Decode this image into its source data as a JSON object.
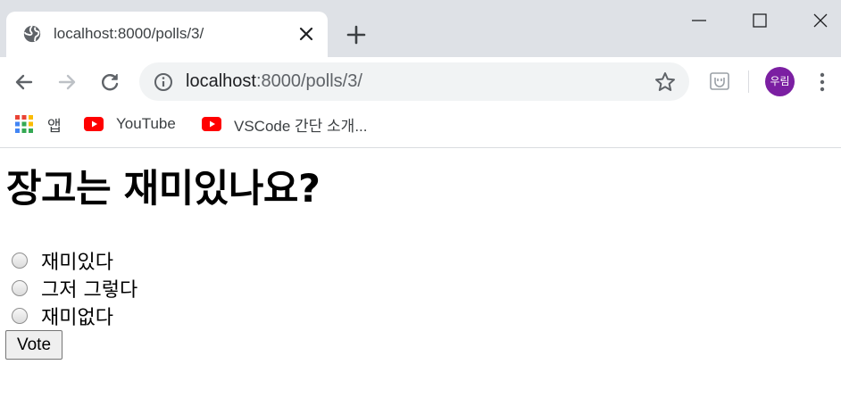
{
  "browser": {
    "tab": {
      "title": "localhost:8000/polls/3/"
    },
    "address_bar": {
      "host": "localhost",
      "rest": ":8000/polls/3/"
    },
    "profile": {
      "initials": "우림",
      "color": "#7b1fa2"
    },
    "bookmarks": [
      {
        "label": "앱",
        "icon": "apps-grid-icon"
      },
      {
        "label": "YouTube",
        "icon": "youtube-icon"
      },
      {
        "label": "VSCode 간단 소개...",
        "icon": "youtube-icon"
      }
    ]
  },
  "page": {
    "question": "장고는 재미있나요?",
    "choices": [
      {
        "label": "재미있다",
        "selected": false
      },
      {
        "label": "그저 그렇다",
        "selected": false
      },
      {
        "label": "재미없다",
        "selected": false
      }
    ],
    "vote_label": "Vote"
  },
  "colors": {
    "tabstrip": "#dee1e6",
    "omnibox": "#f1f3f4",
    "youtube_red": "#ff0000"
  }
}
